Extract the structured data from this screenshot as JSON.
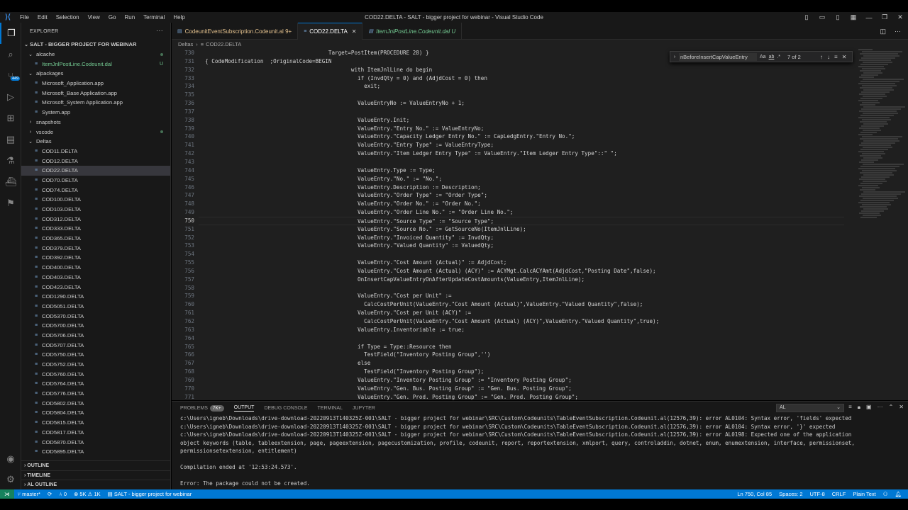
{
  "window": {
    "title": "COD22.DELTA - SALT - bigger project for webinar - Visual Studio Code"
  },
  "menu": [
    "File",
    "Edit",
    "Selection",
    "View",
    "Go",
    "Run",
    "Terminal",
    "Help"
  ],
  "activity_badge": "449",
  "explorer": {
    "title": "EXPLORER",
    "project": "SALT - BIGGER PROJECT FOR WEBINAR",
    "items": [
      {
        "label": "alcache",
        "kind": "folder",
        "indent": 1,
        "open": true,
        "dot": true
      },
      {
        "label": "ItemJnlPostLine.Codeunit.dal",
        "kind": "file",
        "indent": 2,
        "badge": "U",
        "green": true
      },
      {
        "label": "alpackages",
        "kind": "folder",
        "indent": 1,
        "open": true
      },
      {
        "label": "Microsoft_Application.app",
        "kind": "file",
        "indent": 2
      },
      {
        "label": "Microsoft_Base Application.app",
        "kind": "file",
        "indent": 2
      },
      {
        "label": "Microsoft_System Application.app",
        "kind": "file",
        "indent": 2
      },
      {
        "label": "System.app",
        "kind": "file",
        "indent": 2
      },
      {
        "label": "snapshots",
        "kind": "folder",
        "indent": 1,
        "open": false
      },
      {
        "label": "vscode",
        "kind": "folder",
        "indent": 1,
        "open": false,
        "dot": true
      },
      {
        "label": "Deltas",
        "kind": "folder",
        "indent": 1,
        "open": true
      },
      {
        "label": "COD11.DELTA",
        "kind": "file",
        "indent": 2
      },
      {
        "label": "COD12.DELTA",
        "kind": "file",
        "indent": 2
      },
      {
        "label": "COD22.DELTA",
        "kind": "file",
        "indent": 2,
        "selected": true
      },
      {
        "label": "COD70.DELTA",
        "kind": "file",
        "indent": 2
      },
      {
        "label": "COD74.DELTA",
        "kind": "file",
        "indent": 2
      },
      {
        "label": "COD100.DELTA",
        "kind": "file",
        "indent": 2
      },
      {
        "label": "COD103.DELTA",
        "kind": "file",
        "indent": 2
      },
      {
        "label": "COD312.DELTA",
        "kind": "file",
        "indent": 2
      },
      {
        "label": "COD333.DELTA",
        "kind": "file",
        "indent": 2
      },
      {
        "label": "COD365.DELTA",
        "kind": "file",
        "indent": 2
      },
      {
        "label": "COD379.DELTA",
        "kind": "file",
        "indent": 2
      },
      {
        "label": "COD392.DELTA",
        "kind": "file",
        "indent": 2
      },
      {
        "label": "COD400.DELTA",
        "kind": "file",
        "indent": 2
      },
      {
        "label": "COD403.DELTA",
        "kind": "file",
        "indent": 2
      },
      {
        "label": "COD423.DELTA",
        "kind": "file",
        "indent": 2
      },
      {
        "label": "COD1290.DELTA",
        "kind": "file",
        "indent": 2
      },
      {
        "label": "COD5051.DELTA",
        "kind": "file",
        "indent": 2
      },
      {
        "label": "COD5370.DELTA",
        "kind": "file",
        "indent": 2
      },
      {
        "label": "COD5700.DELTA",
        "kind": "file",
        "indent": 2
      },
      {
        "label": "COD5706.DELTA",
        "kind": "file",
        "indent": 2
      },
      {
        "label": "COD5707.DELTA",
        "kind": "file",
        "indent": 2
      },
      {
        "label": "COD5750.DELTA",
        "kind": "file",
        "indent": 2
      },
      {
        "label": "COD5752.DELTA",
        "kind": "file",
        "indent": 2
      },
      {
        "label": "COD5760.DELTA",
        "kind": "file",
        "indent": 2
      },
      {
        "label": "COD5764.DELTA",
        "kind": "file",
        "indent": 2
      },
      {
        "label": "COD5776.DELTA",
        "kind": "file",
        "indent": 2
      },
      {
        "label": "COD5802.DELTA",
        "kind": "file",
        "indent": 2
      },
      {
        "label": "COD5804.DELTA",
        "kind": "file",
        "indent": 2
      },
      {
        "label": "COD5815.DELTA",
        "kind": "file",
        "indent": 2
      },
      {
        "label": "COD5817.DELTA",
        "kind": "file",
        "indent": 2
      },
      {
        "label": "COD5870.DELTA",
        "kind": "file",
        "indent": 2
      },
      {
        "label": "COD5895.DELTA",
        "kind": "file",
        "indent": 2
      }
    ],
    "sections": [
      "OUTLINE",
      "TIMELINE",
      "AL OUTLINE"
    ]
  },
  "tabs": [
    {
      "label": "CodeunitEventSubscription.Codeunit.al",
      "suffix": "9+",
      "state": "mod"
    },
    {
      "label": "COD22.DELTA",
      "suffix": "",
      "state": "active"
    },
    {
      "label": "ItemJnlPostLine.Codeunit.dal",
      "suffix": "U",
      "state": "untracked"
    }
  ],
  "breadcrumb": [
    "Deltas",
    "COD22.DELTA"
  ],
  "editor": {
    "current_line": 750,
    "lines": [
      {
        "n": "730",
        "t": "                                        Target=PostItem(PROCEDURE 28) }"
      },
      {
        "n": "731",
        "t": "  { CodeModification  ;OriginalCode=BEGIN"
      },
      {
        "n": "732",
        "t": "                                               with ItemJnlLine do begin"
      },
      {
        "n": "733",
        "t": "                                                 if (InvdQty = 0) and (AdjdCost = 0) then"
      },
      {
        "n": "734",
        "t": "                                                   exit;"
      },
      {
        "n": "735",
        "t": ""
      },
      {
        "n": "736",
        "t": "                                                 ValueEntryNo := ValueEntryNo + 1;"
      },
      {
        "n": "737",
        "t": ""
      },
      {
        "n": "738",
        "t": "                                                 ValueEntry.Init;"
      },
      {
        "n": "739",
        "t": "                                                 ValueEntry.\"Entry No.\" := ValueEntryNo;"
      },
      {
        "n": "740",
        "t": "                                                 ValueEntry.\"Capacity Ledger Entry No.\" := CapLedgEntry.\"Entry No.\";"
      },
      {
        "n": "741",
        "t": "                                                 ValueEntry.\"Entry Type\" := ValueEntryType;"
      },
      {
        "n": "742",
        "t": "                                                 ValueEntry.\"Item Ledger Entry Type\" := ValueEntry.\"Item Ledger Entry Type\"::\" \";"
      },
      {
        "n": "743",
        "t": ""
      },
      {
        "n": "744",
        "t": "                                                 ValueEntry.Type := Type;"
      },
      {
        "n": "745",
        "t": "                                                 ValueEntry.\"No.\" := \"No.\";"
      },
      {
        "n": "746",
        "t": "                                                 ValueEntry.Description := Description;"
      },
      {
        "n": "747",
        "t": "                                                 ValueEntry.\"Order Type\" := \"Order Type\";"
      },
      {
        "n": "748",
        "t": "                                                 ValueEntry.\"Order No.\" := \"Order No.\";"
      },
      {
        "n": "749",
        "t": "                                                 ValueEntry.\"Order Line No.\" := \"Order Line No.\";"
      },
      {
        "n": "750",
        "t": "                                                 ValueEntry.\"Source Type\" := \"Source Type\";"
      },
      {
        "n": "751",
        "t": "                                                 ValueEntry.\"Source No.\" := GetSourceNo(ItemJnlLine);"
      },
      {
        "n": "752",
        "t": "                                                 ValueEntry.\"Invoiced Quantity\" := InvdQty;"
      },
      {
        "n": "753",
        "t": "                                                 ValueEntry.\"Valued Quantity\" := ValuedQty;"
      },
      {
        "n": "754",
        "t": ""
      },
      {
        "n": "755",
        "t": "                                                 ValueEntry.\"Cost Amount (Actual)\" := AdjdCost;"
      },
      {
        "n": "756",
        "t": "                                                 ValueEntry.\"Cost Amount (Actual) (ACY)\" := ACYMgt.CalcACYAmt(AdjdCost,\"Posting Date\",false);"
      },
      {
        "n": "757",
        "t": "                                                 OnInsertCapValueEntryOnAfterUpdateCostAmounts(ValueEntry,ItemJnlLine);"
      },
      {
        "n": "758",
        "t": ""
      },
      {
        "n": "759",
        "t": "                                                 ValueEntry.\"Cost per Unit\" :="
      },
      {
        "n": "760",
        "t": "                                                   CalcCostPerUnit(ValueEntry.\"Cost Amount (Actual)\",ValueEntry.\"Valued Quantity\",false);"
      },
      {
        "n": "761",
        "t": "                                                 ValueEntry.\"Cost per Unit (ACY)\" :="
      },
      {
        "n": "762",
        "t": "                                                   CalcCostPerUnit(ValueEntry.\"Cost Amount (Actual) (ACY)\",ValueEntry.\"Valued Quantity\",true);"
      },
      {
        "n": "763",
        "t": "                                                 ValueEntry.Inventoriable := true;"
      },
      {
        "n": "764",
        "t": ""
      },
      {
        "n": "765",
        "t": "                                                 if Type = Type::Resource then"
      },
      {
        "n": "766",
        "t": "                                                   TestField(\"Inventory Posting Group\",'')"
      },
      {
        "n": "767",
        "t": "                                                 else"
      },
      {
        "n": "768",
        "t": "                                                   TestField(\"Inventory Posting Group\");"
      },
      {
        "n": "769",
        "t": "                                                 ValueEntry.\"Inventory Posting Group\" := \"Inventory Posting Group\";"
      },
      {
        "n": "770",
        "t": "                                                 ValueEntry.\"Gen. Bus. Posting Group\" := \"Gen. Bus. Posting Group\";"
      },
      {
        "n": "771",
        "t": "                                                 ValueEntry.\"Gen. Prod. Posting Group\" := \"Gen. Prod. Posting Group\";"
      }
    ]
  },
  "find": {
    "value": "nBeforeInsertCapValueEntry",
    "opt_case": "Aa",
    "opt_word": "ab",
    "opt_regex": ".*",
    "count": "7 of 2"
  },
  "panel": {
    "tabs": [
      "PROBLEMS",
      "OUTPUT",
      "DEBUG CONSOLE",
      "TERMINAL",
      "JUPYTER"
    ],
    "problems_count": "7K+",
    "active": "OUTPUT",
    "channel": "AL",
    "output": [
      "c:\\Users\\igneb\\Downloads\\drive-download-20220913T140325Z-001\\SALT - bigger project for webinar\\SRC\\Custom\\Codeunits\\TableEventSubscription.Codeunit.al(12576,39): error AL0104: Syntax error, 'fields' expected",
      "c:\\Users\\igneb\\Downloads\\drive-download-20220913T140325Z-001\\SALT - bigger project for webinar\\SRC\\Custom\\Codeunits\\TableEventSubscription.Codeunit.al(12576,39): error AL0104: Syntax error, '}' expected",
      "c:\\Users\\igneb\\Downloads\\drive-download-20220913T140325Z-001\\SALT - bigger project for webinar\\SRC\\Custom\\Codeunits\\TableEventSubscription.Codeunit.al(12576,39): error AL0198: Expected one of the application",
      "object keywords (table, tableextension, page, pageextension, pagecustomization, profile, codeunit, report, reportextension, xmlport, query, controladdin, dotnet, enum, enumextension, interface, permissionset,",
      "permissionsetextension, entitlement)",
      "",
      "Compilation ended at '12:53:24.573'.",
      "",
      "Error: The package could not be created."
    ]
  },
  "status": {
    "branch": "master*",
    "errors": "0",
    "problems": "5K",
    "warnings": "1K",
    "project": "SALT - bigger project for webinar",
    "position": "Ln 750, Col 85",
    "spaces": "Spaces: 2",
    "encoding": "UTF-8",
    "eol": "CRLF",
    "language": "Plain Text"
  }
}
